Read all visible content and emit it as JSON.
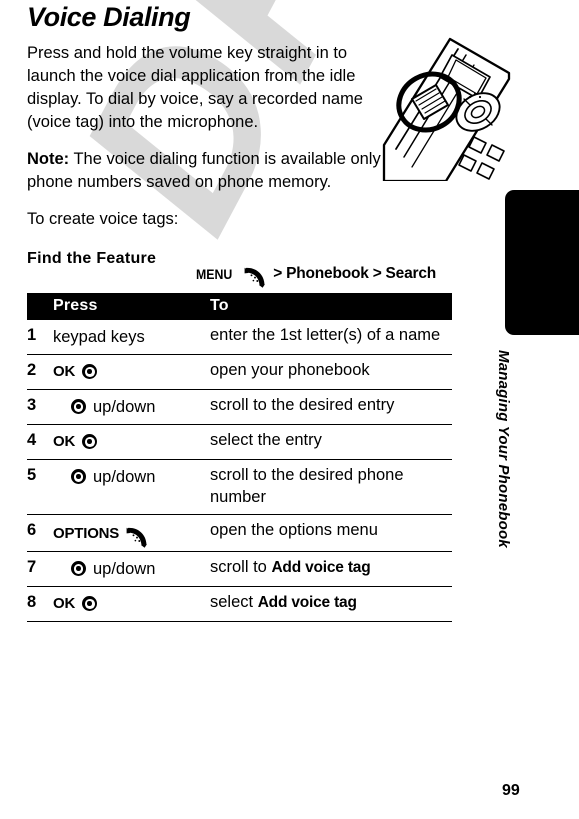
{
  "document": {
    "title": "Voice Dialing",
    "page_number": "99",
    "side_tab_title": "Managing Your Phonebook",
    "watermark": "DRAFT"
  },
  "intro": {
    "paragraph": "Press and hold the volume key straight in to launch the voice dial application from the idle display. To dial by voice, say a recorded name (voice tag) into the microphone.",
    "note_label": "Note:",
    "note_text": " The voice dialing function is available only for the phone numbers saved on phone memory.",
    "lead_in": "To create voice tags:"
  },
  "find_feature": {
    "label": "Find the Feature",
    "menu_label": "MENU",
    "separator": ">",
    "path_item_1": "Phonebook",
    "path_item_2": "Search"
  },
  "table": {
    "headers": {
      "number": "",
      "press": "Press",
      "to": "To"
    },
    "rows": [
      {
        "num": "1",
        "press_text": "keypad keys",
        "press_key": "",
        "press_icon": "",
        "press_suffix": "",
        "to_text": "enter the 1st letter(s) of a name",
        "to_strong": ""
      },
      {
        "num": "2",
        "press_text": "",
        "press_key": "OK",
        "press_icon": "nav-ring-icon",
        "press_suffix": "",
        "to_text": "open your phonebook",
        "to_strong": ""
      },
      {
        "num": "3",
        "press_text": "",
        "press_key": "",
        "press_icon": "nav-ring-icon",
        "press_suffix": "up/down",
        "to_text": "scroll to the desired entry",
        "to_strong": ""
      },
      {
        "num": "4",
        "press_text": "",
        "press_key": "OK",
        "press_icon": "nav-ring-icon",
        "press_suffix": "",
        "to_text": "select the entry",
        "to_strong": ""
      },
      {
        "num": "5",
        "press_text": "",
        "press_key": "",
        "press_icon": "nav-ring-icon",
        "press_suffix": "up/down",
        "to_text": "scroll to the desired phone number",
        "to_strong": ""
      },
      {
        "num": "6",
        "press_text": "",
        "press_key": "OPTIONS",
        "press_icon": "softkey-icon",
        "press_suffix": "",
        "to_text": "open the options menu",
        "to_strong": ""
      },
      {
        "num": "7",
        "press_text": "",
        "press_key": "",
        "press_icon": "nav-ring-icon",
        "press_suffix": "up/down",
        "to_text": "scroll to ",
        "to_strong": "Add voice tag"
      },
      {
        "num": "8",
        "press_text": "",
        "press_key": "OK",
        "press_icon": "nav-ring-icon",
        "press_suffix": "",
        "to_text": "select ",
        "to_strong": "Add voice tag"
      }
    ]
  },
  "illustration": {
    "name": "phone-volume-key-illustration",
    "description": "Line drawing of phone side showing volume key circled"
  },
  "colors": {
    "ink": "#000000",
    "paper": "#ffffff",
    "watermark": "#d9d9d9"
  }
}
